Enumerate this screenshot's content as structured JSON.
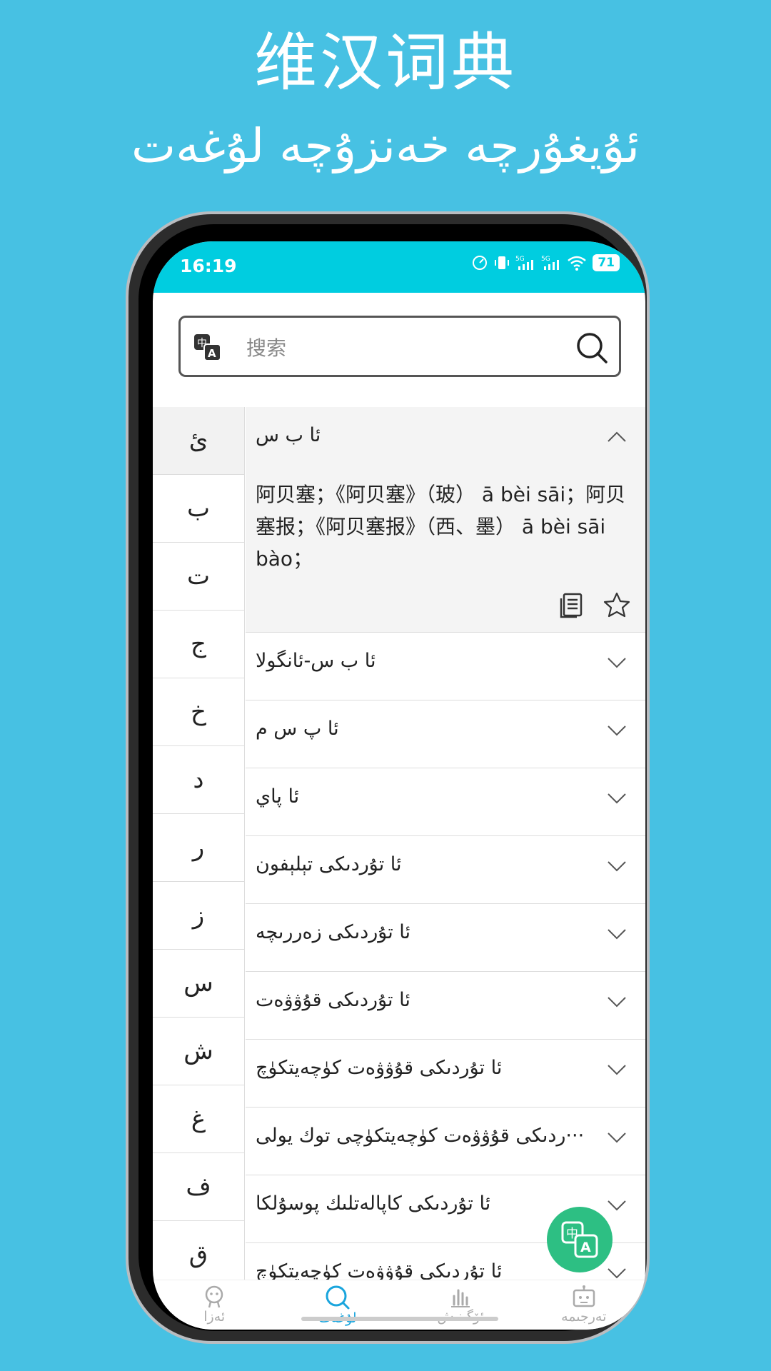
{
  "promo": {
    "title": "维汉词典",
    "subtitle": "ئۇيغۇرچە خەنزۇچە لۇغەت"
  },
  "status_bar": {
    "time": "16:19",
    "battery": "71"
  },
  "search": {
    "placeholder": "搜索"
  },
  "alphabet": [
    "ئ",
    "ب",
    "ت",
    "ج",
    "خ",
    "د",
    "ر",
    "ز",
    "س",
    "ش",
    "غ",
    "ف",
    "ق"
  ],
  "expanded_entry": {
    "word": "ئا ب س",
    "definition": "阿贝塞；《阿贝塞》（玻） ā bèi sāi；阿贝塞报；《阿贝塞报》（西、墨） ā bèi sāi bào；"
  },
  "entries": [
    "ئا ب س-ئانگولا",
    "ئا پ س م",
    "ئا پاي",
    "ئا تۇردىكى تېلېفون",
    "ئا تۇردىكى زەررىچە",
    "ئا تۇردىكى قۇۋۋەت",
    "ئا تۇردىكى قۇۋۋەت كۈچەيتكۈچ",
    "···ردىكى قۇۋۋەت كۈچەيتكۈچى توك يولى",
    "ئا تۇردىكى كاپالەتلىك پوسۇلكا",
    "ئا تۇردىكى قۇۋۋەت كۈچەيتكۈچ"
  ],
  "tabs": [
    {
      "label": "ئەزا",
      "icon": "member-icon"
    },
    {
      "label": "لۇغەت",
      "icon": "search-icon"
    },
    {
      "label": "ئۆگىنىش",
      "icon": "chart-icon"
    },
    {
      "label": "تەرجىمە",
      "icon": "robot-icon"
    }
  ],
  "colors": {
    "background": "#47c1e3",
    "status_bar": "#00cde0",
    "accent": "#1aa5dd",
    "fab": "#2dbf83"
  }
}
